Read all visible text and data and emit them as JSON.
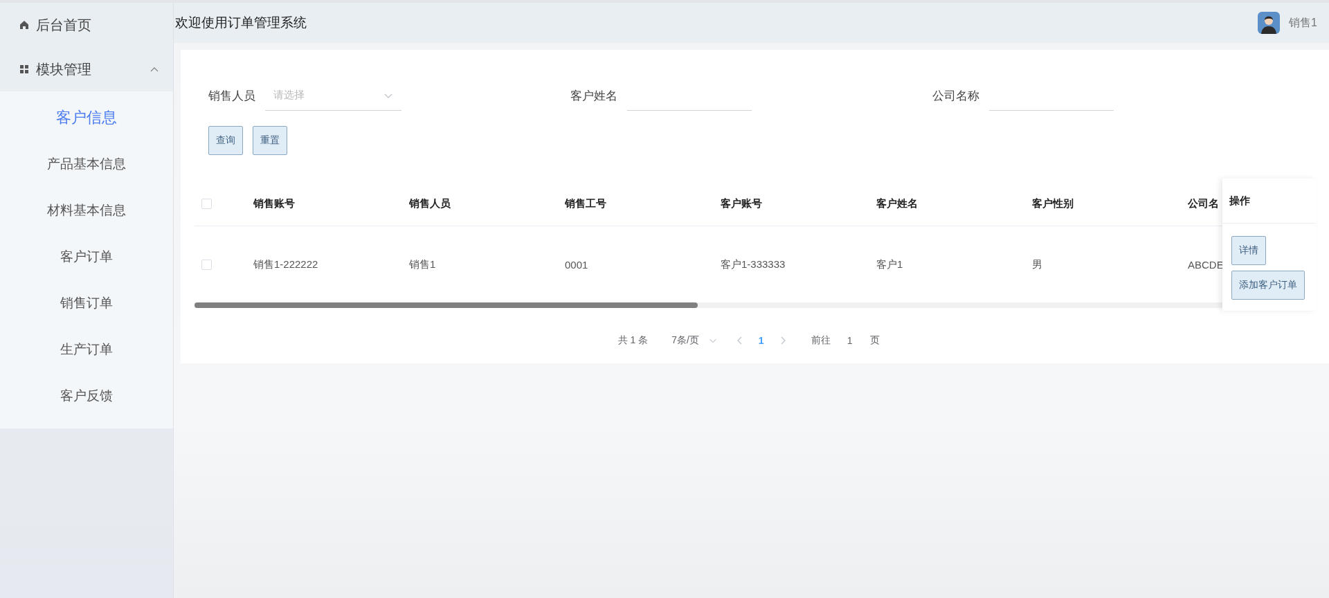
{
  "sidebar": {
    "items": [
      {
        "label": "后台首页",
        "kind": "link",
        "selected": false
      },
      {
        "label": "模块管理",
        "kind": "group",
        "expanded": true,
        "selected": false,
        "children": [
          {
            "label": "客户信息",
            "selected": true
          },
          {
            "label": "产品基本信息",
            "selected": false
          },
          {
            "label": "材料基本信息",
            "selected": false
          },
          {
            "label": "客户订单",
            "selected": false
          },
          {
            "label": "销售订单",
            "selected": false
          },
          {
            "label": "生产订单",
            "selected": false
          },
          {
            "label": "客户反馈",
            "selected": false
          }
        ]
      }
    ]
  },
  "header": {
    "title": "欢迎使用订单管理系统",
    "user": "销售1"
  },
  "filters": [
    {
      "label": "销售人员",
      "kind": "select",
      "placeholder": "请选择"
    },
    {
      "label": "客户姓名",
      "kind": "input"
    },
    {
      "label": "公司名称",
      "kind": "input"
    }
  ],
  "actions": [
    "查询",
    "重置"
  ],
  "table": {
    "select_all": {
      "checked": false
    },
    "columns": [
      "销售账号",
      "销售人员",
      "销售工号",
      "客户账号",
      "客户姓名",
      "客户性别",
      "公司名"
    ],
    "action_column": "操作",
    "rows": [
      {
        "checked": false,
        "cells": [
          "销售1-222222",
          "销售1",
          "0001",
          "客户1-333333",
          "客户1",
          "男",
          "ABCDE"
        ],
        "actions": [
          "详情",
          "添加客户订单"
        ]
      }
    ]
  },
  "pagination": {
    "total": "共 1 条",
    "page_size": "7条/页",
    "pages": [
      {
        "label": "1",
        "selected": true
      }
    ],
    "jump_label": "前往",
    "jump_value": "1",
    "jump_suffix": "页"
  }
}
